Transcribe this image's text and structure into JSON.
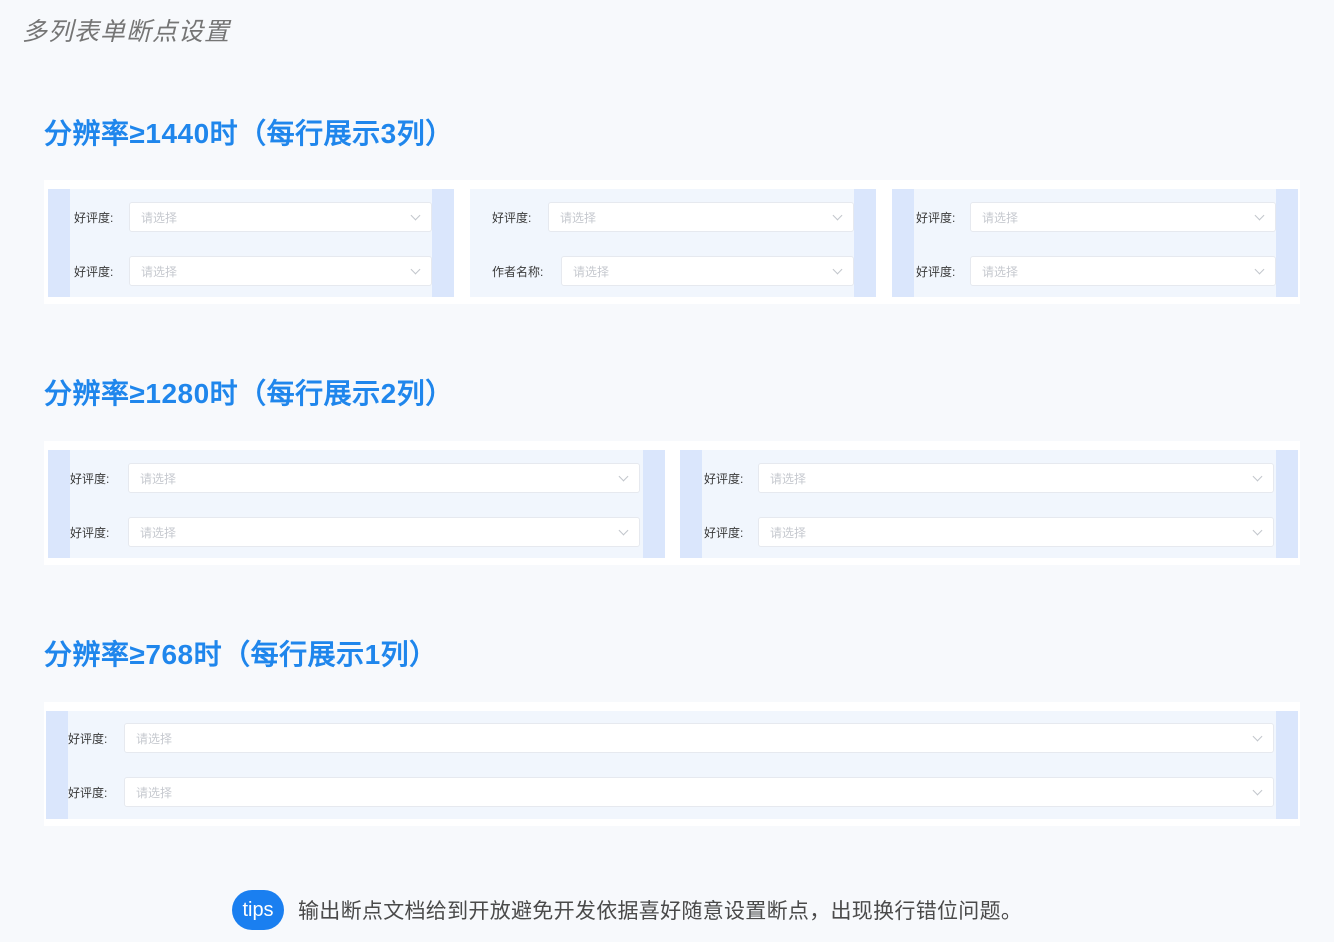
{
  "page_title": "多列表单断点设置",
  "sections": [
    {
      "title": "分辨率≥1440时（每行展示3列）",
      "columns": [
        {
          "fields": [
            {
              "label": "好评度:",
              "placeholder": "请选择"
            },
            {
              "label": "好评度:",
              "placeholder": "请选择"
            }
          ]
        },
        {
          "fields": [
            {
              "label": "好评度:",
              "placeholder": "请选择"
            },
            {
              "label": "作者名称:",
              "placeholder": "请选择"
            }
          ]
        },
        {
          "fields": [
            {
              "label": "好评度:",
              "placeholder": "请选择"
            },
            {
              "label": "好评度:",
              "placeholder": "请选择"
            }
          ]
        }
      ]
    },
    {
      "title": "分辨率≥1280时（每行展示2列）",
      "columns": [
        {
          "fields": [
            {
              "label": "好评度:",
              "placeholder": "请选择"
            },
            {
              "label": "好评度:",
              "placeholder": "请选择"
            }
          ]
        },
        {
          "fields": [
            {
              "label": "好评度:",
              "placeholder": "请选择"
            },
            {
              "label": "好评度:",
              "placeholder": "请选择"
            }
          ]
        }
      ]
    },
    {
      "title": "分辨率≥768时（每行展示1列）",
      "columns": [
        {
          "fields": [
            {
              "label": "好评度:",
              "placeholder": "请选择"
            },
            {
              "label": "好评度:",
              "placeholder": "请选择"
            }
          ]
        }
      ]
    }
  ],
  "tips": {
    "badge": "tips",
    "text": "输出断点文档给到开放避免开发依据喜好随意设置断点，出现换行错位问题。"
  }
}
